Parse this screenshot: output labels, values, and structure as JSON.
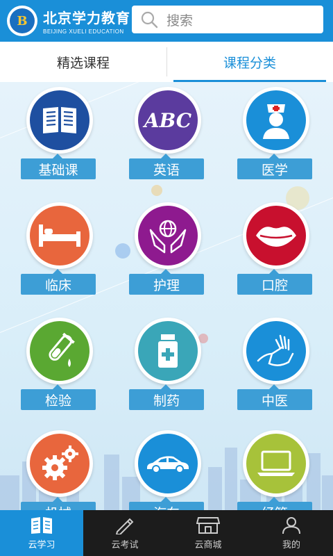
{
  "header": {
    "logo_text": "B",
    "brand_cn": "北京学力教育",
    "brand_en": "BEIJING XUELI EDUCATION",
    "search_placeholder": "搜索"
  },
  "tabs": [
    {
      "label": "精选课程",
      "active": false
    },
    {
      "label": "课程分类",
      "active": true
    }
  ],
  "categories": [
    {
      "label": "基础课",
      "icon": "book-icon",
      "color": "#1e4fa0"
    },
    {
      "label": "英语",
      "icon": "abc-icon",
      "color": "#5b3b9e",
      "icon_text": "ABC"
    },
    {
      "label": "医学",
      "icon": "nurse-icon",
      "color": "#1a8fd8"
    },
    {
      "label": "临床",
      "icon": "bed-icon",
      "color": "#e8663d"
    },
    {
      "label": "护理",
      "icon": "hands-globe-icon",
      "color": "#8e1a8f"
    },
    {
      "label": "口腔",
      "icon": "lips-icon",
      "color": "#c8102e"
    },
    {
      "label": "检验",
      "icon": "test-tube-icon",
      "color": "#5aa832"
    },
    {
      "label": "制药",
      "icon": "medicine-bottle-icon",
      "color": "#3aa6b8"
    },
    {
      "label": "中医",
      "icon": "pulse-hand-icon",
      "color": "#1a8fd8"
    },
    {
      "label": "机械",
      "icon": "gears-icon",
      "color": "#e8663d"
    },
    {
      "label": "汽车",
      "icon": "car-icon",
      "color": "#1a8fd8"
    },
    {
      "label": "经管",
      "icon": "laptop-icon",
      "color": "#a7c23a"
    }
  ],
  "bottom_nav": [
    {
      "label": "云学习",
      "icon": "book-open-icon",
      "active": true
    },
    {
      "label": "云考试",
      "icon": "pen-icon",
      "active": false
    },
    {
      "label": "云商城",
      "icon": "store-icon",
      "active": false
    },
    {
      "label": "我的",
      "icon": "user-icon",
      "active": false
    }
  ],
  "colors": {
    "primary": "#1a8fd8",
    "label_bg": "#3d9ed6",
    "nav_bg": "#1c1c1c"
  }
}
